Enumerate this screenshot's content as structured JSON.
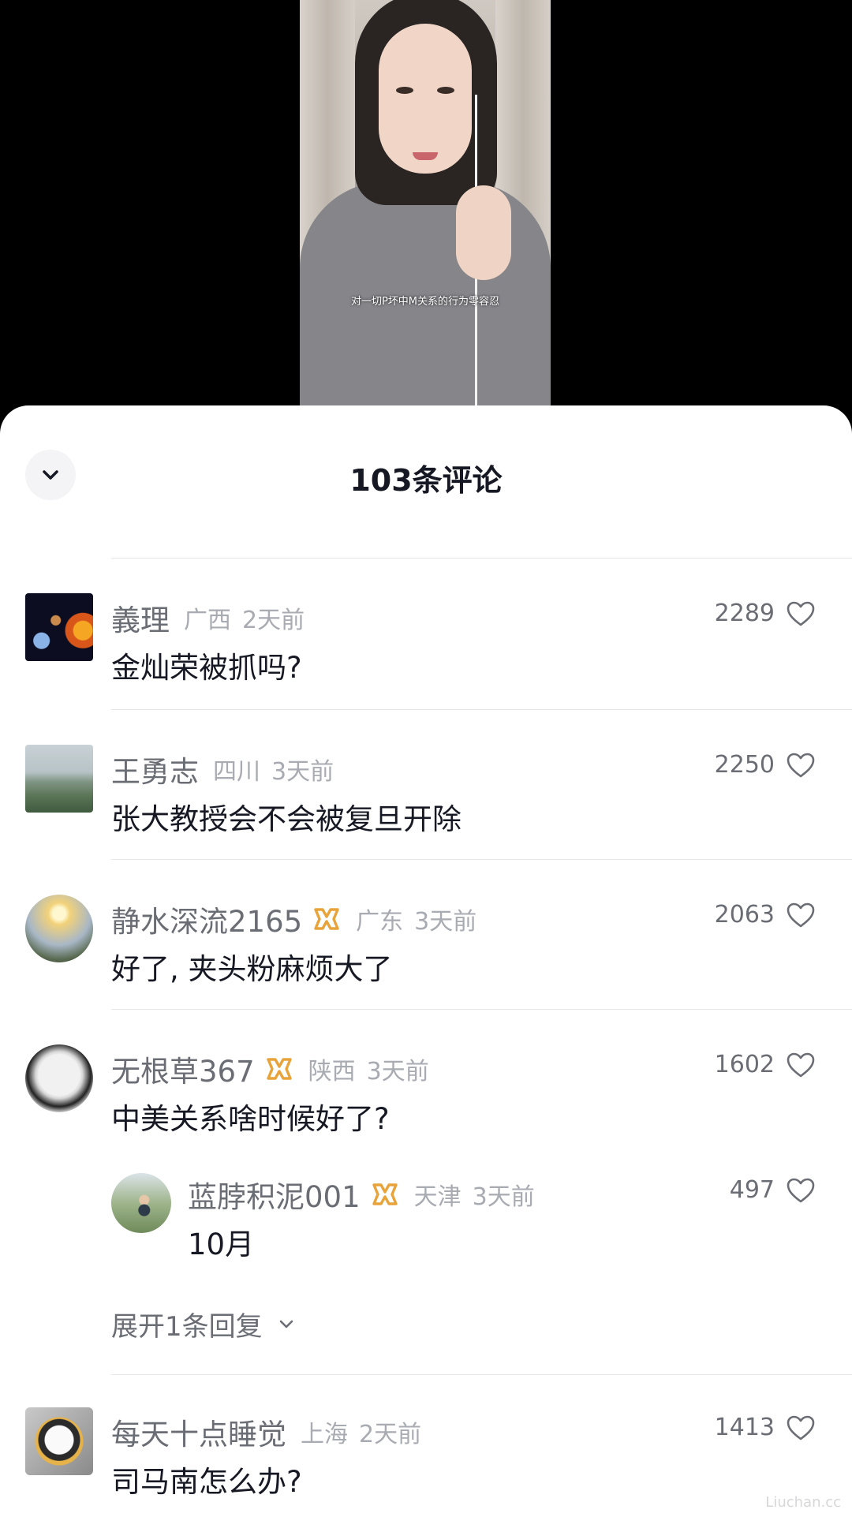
{
  "video": {
    "subtitle": "对一切P坏中M关系的行为零容忍"
  },
  "sheet": {
    "title": "103条评论"
  },
  "comments": [
    {
      "username": "義理",
      "region": "广西",
      "time": "2天前",
      "text": "金灿荣被抓吗?",
      "likes": "2289",
      "avatar": "planets-avatar"
    },
    {
      "username": "王勇志",
      "region": "四川",
      "time": "3天前",
      "text": "张大教授会不会被复旦开除",
      "likes": "2250",
      "avatar": "mountain-avatar"
    },
    {
      "username": "静水深流2165",
      "region": "广东",
      "time": "3天前",
      "text": "好了, 夹头粉麻烦大了",
      "likes": "2063",
      "avatar": "sunset-avatar",
      "badge": true
    },
    {
      "username": "无根草367",
      "region": "陕西",
      "time": "3天前",
      "text": "中美关系啥时候好了?",
      "likes": "1602",
      "avatar": "bowl-avatar",
      "badge": true
    },
    {
      "username": "每天十点睡觉",
      "region": "上海",
      "time": "2天前",
      "text": "司马南怎么办?",
      "likes": "1413",
      "avatar": "cat-avatar"
    }
  ],
  "reply": {
    "username": "蓝脖积泥001",
    "region": "天津",
    "time": "3天前",
    "text": "10月",
    "likes": "497",
    "avatar": "person-avatar",
    "badge": true
  },
  "expand_replies": "展开1条回复",
  "colors": {
    "badge_gold": "#e8a33a",
    "like_icon": "#6b6d75"
  },
  "watermark": "Liuchan.cc"
}
